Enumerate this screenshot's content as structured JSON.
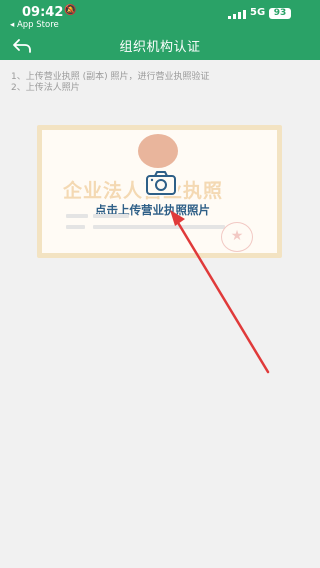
{
  "status_bar": {
    "time": "09:42",
    "back_app": "◂ App Store",
    "network": "5G",
    "battery": "93"
  },
  "header": {
    "title": "组织机构认证"
  },
  "instructions": [
    "1、上传营业执照 (副本) 照片，进行营业执照验证",
    "2、上传法人照片"
  ],
  "upload_card": {
    "watermark_text": "企业法人营业执照",
    "action_label": "点击上传营业执照照片"
  },
  "colors": {
    "header_bg": "#2aa267",
    "annotation_arrow": "#e03a3a"
  }
}
